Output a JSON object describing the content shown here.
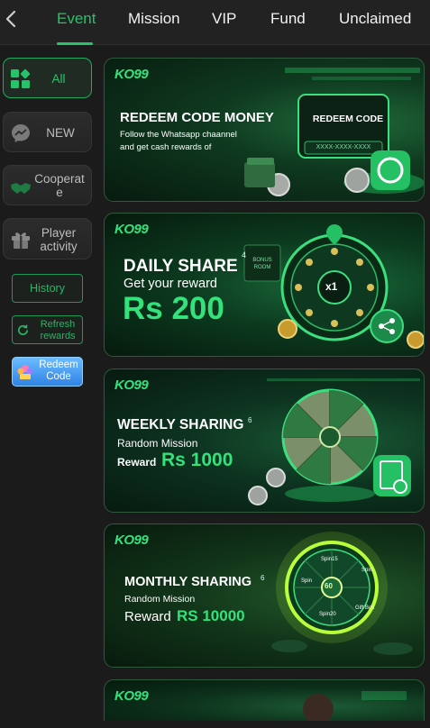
{
  "nav": {
    "tabs": [
      "Event",
      "Mission",
      "VIP",
      "Fund",
      "Unclaimed"
    ],
    "active_tab": "Event"
  },
  "sidebar": {
    "categories": [
      {
        "label": "All",
        "icon": "grid-icon",
        "active": true
      },
      {
        "label": "NEW",
        "icon": "messenger-icon",
        "active": false
      },
      {
        "label": "Cooperate",
        "icon": "handshake-icon",
        "active": false
      },
      {
        "label": "Player activity",
        "icon": "gift-icon",
        "active": false
      }
    ],
    "history_label": "History",
    "refresh_label": "Refresh rewards",
    "redeem_label": "Redeem Code"
  },
  "banners": [
    {
      "logo": "KO99",
      "title": "REDEEM CODE MONEY",
      "line1": "Follow the Whatsapp chaannel",
      "line2": "and get cash rewards of",
      "card_title": "REDEEM CODE",
      "card_code": "XXXX-XXXX-XXXX"
    },
    {
      "logo": "KO99",
      "title": "DAILY SHARE",
      "subtitle": "Get your reward",
      "amount": "Rs 200",
      "wheel_center": "x1",
      "wheel_badge": "4",
      "sign": "BONUS ROOM"
    },
    {
      "logo": "KO99",
      "title": "WEEKLY SHARING",
      "badge": "6",
      "subtitle": "Random Mission",
      "reward_label": "Reward",
      "amount": "Rs 1000"
    },
    {
      "logo": "KO99",
      "title": "MONTHLY SHARING",
      "badge": "6",
      "subtitle": "Random Mission",
      "reward_label": "Reward",
      "amount": "RS 10000",
      "wheel_center": "60",
      "wheel_labels": [
        "Spin15",
        "Spin",
        "Gift Box",
        "Spin20",
        "Spin"
      ]
    },
    {
      "logo": "KO99"
    }
  ],
  "colors": {
    "accent": "#27c36b",
    "background": "#1b1b1b",
    "redeem_blue": "#3b8ef0"
  }
}
